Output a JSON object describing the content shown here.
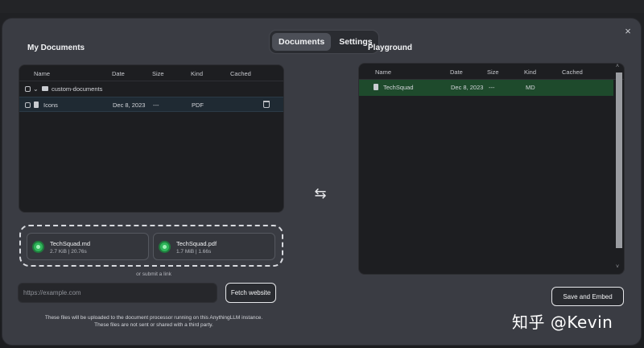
{
  "tabs": [
    {
      "label": "Documents",
      "active": true
    },
    {
      "label": "Settings",
      "active": false
    }
  ],
  "close_label": "×",
  "left": {
    "title": "My Documents",
    "columns": [
      "Name",
      "Date",
      "Size",
      "Kind",
      "Cached"
    ],
    "folder": {
      "name": "custom-documents"
    },
    "rows": [
      {
        "name": "Icons",
        "date": "Dec 8, 2023",
        "size": "---",
        "kind": "PDF"
      }
    ]
  },
  "uploads": [
    {
      "name": "TechSquad.md",
      "meta": "2.7 KiB | 20.76s"
    },
    {
      "name": "TechSquad.pdf",
      "meta": "1.7 MiB | 1.66s"
    }
  ],
  "submit_link_text": "or submit a link",
  "url_input": {
    "placeholder": "https://example.com",
    "value": ""
  },
  "fetch_button": "Fetch website",
  "disclaimer": [
    "These files will be uploaded to the document processor running on this AnythingLLM instance.",
    "These files are not sent or shared with a third party."
  ],
  "swap_icon": "⇆",
  "right": {
    "title": "Playground",
    "columns": [
      "Name",
      "Date",
      "Size",
      "Kind",
      "Cached"
    ],
    "rows": [
      {
        "name": "TechSquad",
        "date": "Dec 8, 2023",
        "size": "---",
        "kind": "MD"
      }
    ]
  },
  "save_button": "Save and Embed",
  "watermark": "知乎 @Kevin",
  "colors": {
    "modal_bg": "#3a3c43",
    "panel_bg": "#1d1e21",
    "selected_row": "#1f2a33",
    "playground_row": "#1e4a2c",
    "success": "#2fb55a"
  }
}
